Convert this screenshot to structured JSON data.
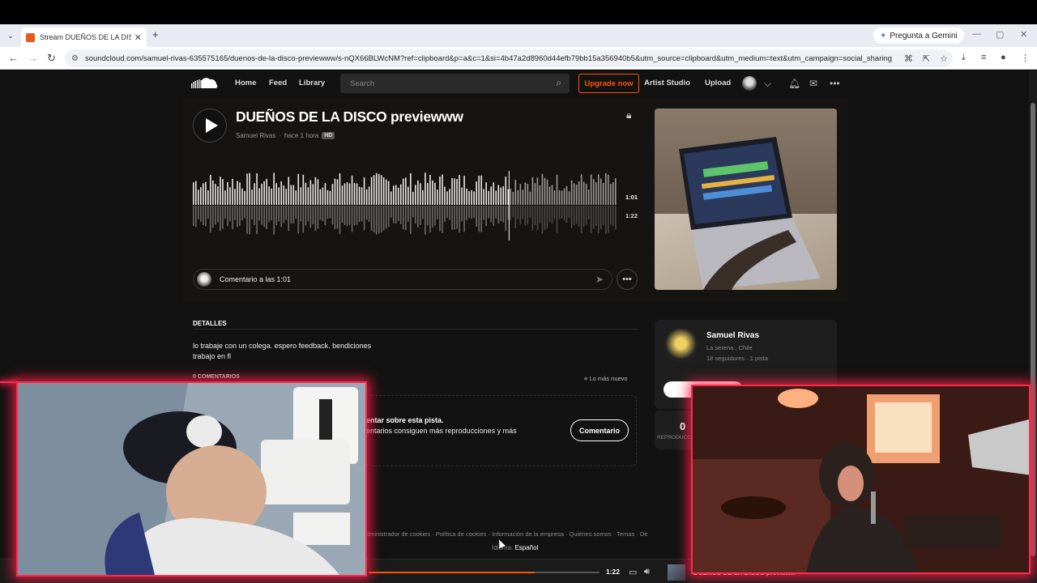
{
  "browser": {
    "tab_title": "Stream DUEÑOS DE LA DISCO p",
    "tab_close": "✕",
    "new_tab": "+",
    "gemini": "Pregunta a Gemini",
    "url": "soundcloud.com/samuel-rivas-635575165/duenos-de-la-disco-previewww/s-nQX66BLWcNM?ref=clipboard&p=a&c=1&si=4b47a2d8960d44efb79bb15a356940b5&utm_source=clipboard&utm_medium=text&utm_campaign=social_sharing"
  },
  "header": {
    "nav": [
      "Home",
      "Feed",
      "Library"
    ],
    "search_placeholder": "Search",
    "upgrade": "Upgrade now",
    "artist_studio": "Artist Studio",
    "upload": "Upload"
  },
  "track": {
    "title": "DUEÑOS DE LA DISCO previewww",
    "artist": "Samuel Rivas",
    "time_ago": "hace 1 hora",
    "hd": "HD",
    "current_time": "1:01",
    "duration": "1:22",
    "progress": 0.744,
    "comment_placeholder": "Comentario a las 1:01"
  },
  "details": {
    "heading": "DETALLES",
    "desc_line1": "lo trabaje con un colega. espero feedback. bendiciones",
    "desc_line2": "trabajo en fl",
    "comments_heading": "0 COMENTARIOS",
    "sort": "Lo más nuevo",
    "cta_line1": "entar sobre esta pista.",
    "cta_line2": "entarios consiguen más reproducciones y más",
    "cta_button": "Comentario"
  },
  "artist_card": {
    "name": "Samuel Rivas",
    "location": "La serena , Chile",
    "stats": "18 seguidores · 1 pista",
    "plays": "0",
    "plays_label": "REPRODUCC"
  },
  "footer": {
    "links": "dministrador de cookies  ·  Política de cookies  ·  Información de la empresa  ·  Quiénes somos  ·  Temas  ·  De",
    "lang_label": "Idioma:",
    "lang_value": "Español"
  },
  "player": {
    "time": "1:22",
    "title": "DUENOS DE LA DISCO preview..."
  },
  "colors": {
    "accent": "#ff5500",
    "neon": "#ff2a4a",
    "page_bg": "#121212"
  }
}
